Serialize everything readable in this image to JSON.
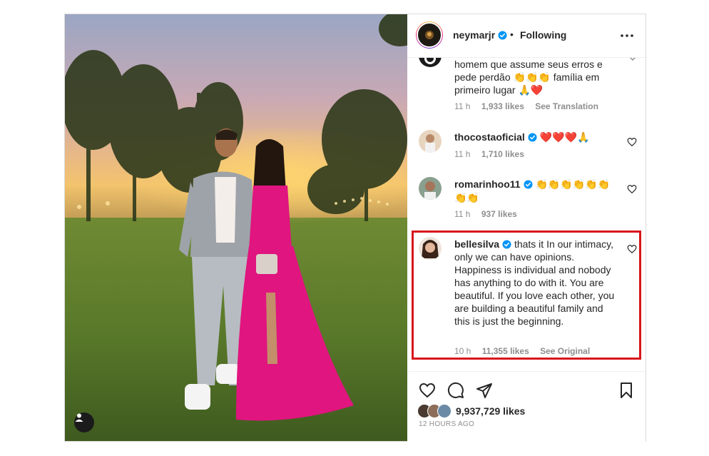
{
  "post": {
    "username": "neymarjr",
    "separator": "•",
    "follow_status": "Following"
  },
  "comments": [
    {
      "username": "",
      "text": "homem que assume seus erros e pede perdão 👏👏👏 família em primeiro lugar 🙏❤️",
      "time": "11 h",
      "likes": "1,933 likes",
      "action": "See Translation"
    },
    {
      "username": "thocostaoficial",
      "text": "❤️❤️❤️🙏",
      "time": "11 h",
      "likes": "1,710 likes"
    },
    {
      "username": "romarinhoo11",
      "text": "👏👏👏👏👏👏👏👏",
      "time": "11 h",
      "likes": "937 likes"
    },
    {
      "username": "bellesilva",
      "text": "thats it In our intimacy, only we can have opinions. Happiness is individual and nobody has anything to do with it. You are beautiful. If you love each other, you are building a beautiful family and this is just the beginning.",
      "time": "10 h",
      "likes": "11,355 likes",
      "action": "See Original"
    }
  ],
  "footer": {
    "likes_count": "9,937,729 likes",
    "posted_ago": "12 HOURS AGO"
  },
  "icons": {
    "more": "more-horizontal-icon",
    "verified": "verified-badge-icon",
    "like": "heart-icon",
    "comment": "comment-icon",
    "share": "paper-plane-icon",
    "save": "bookmark-icon",
    "tag": "user-tag-icon"
  },
  "colors": {
    "verified_blue": "#0095f6",
    "highlight_red": "#d8161b",
    "dress_pink": "#e0157f"
  }
}
